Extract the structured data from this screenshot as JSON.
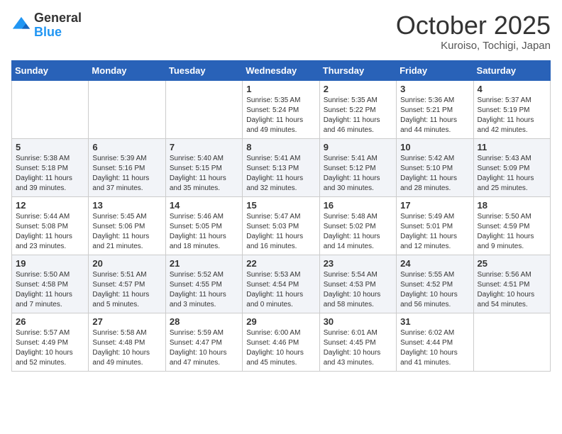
{
  "header": {
    "logo_general": "General",
    "logo_blue": "Blue",
    "month_title": "October 2025",
    "location": "Kuroiso, Tochigi, Japan"
  },
  "weekdays": [
    "Sunday",
    "Monday",
    "Tuesday",
    "Wednesday",
    "Thursday",
    "Friday",
    "Saturday"
  ],
  "rows": [
    {
      "cells": [
        {
          "day": "",
          "info": ""
        },
        {
          "day": "",
          "info": ""
        },
        {
          "day": "",
          "info": ""
        },
        {
          "day": "1",
          "info": "Sunrise: 5:35 AM\nSunset: 5:24 PM\nDaylight: 11 hours\nand 49 minutes."
        },
        {
          "day": "2",
          "info": "Sunrise: 5:35 AM\nSunset: 5:22 PM\nDaylight: 11 hours\nand 46 minutes."
        },
        {
          "day": "3",
          "info": "Sunrise: 5:36 AM\nSunset: 5:21 PM\nDaylight: 11 hours\nand 44 minutes."
        },
        {
          "day": "4",
          "info": "Sunrise: 5:37 AM\nSunset: 5:19 PM\nDaylight: 11 hours\nand 42 minutes."
        }
      ]
    },
    {
      "cells": [
        {
          "day": "5",
          "info": "Sunrise: 5:38 AM\nSunset: 5:18 PM\nDaylight: 11 hours\nand 39 minutes."
        },
        {
          "day": "6",
          "info": "Sunrise: 5:39 AM\nSunset: 5:16 PM\nDaylight: 11 hours\nand 37 minutes."
        },
        {
          "day": "7",
          "info": "Sunrise: 5:40 AM\nSunset: 5:15 PM\nDaylight: 11 hours\nand 35 minutes."
        },
        {
          "day": "8",
          "info": "Sunrise: 5:41 AM\nSunset: 5:13 PM\nDaylight: 11 hours\nand 32 minutes."
        },
        {
          "day": "9",
          "info": "Sunrise: 5:41 AM\nSunset: 5:12 PM\nDaylight: 11 hours\nand 30 minutes."
        },
        {
          "day": "10",
          "info": "Sunrise: 5:42 AM\nSunset: 5:10 PM\nDaylight: 11 hours\nand 28 minutes."
        },
        {
          "day": "11",
          "info": "Sunrise: 5:43 AM\nSunset: 5:09 PM\nDaylight: 11 hours\nand 25 minutes."
        }
      ]
    },
    {
      "cells": [
        {
          "day": "12",
          "info": "Sunrise: 5:44 AM\nSunset: 5:08 PM\nDaylight: 11 hours\nand 23 minutes."
        },
        {
          "day": "13",
          "info": "Sunrise: 5:45 AM\nSunset: 5:06 PM\nDaylight: 11 hours\nand 21 minutes."
        },
        {
          "day": "14",
          "info": "Sunrise: 5:46 AM\nSunset: 5:05 PM\nDaylight: 11 hours\nand 18 minutes."
        },
        {
          "day": "15",
          "info": "Sunrise: 5:47 AM\nSunset: 5:03 PM\nDaylight: 11 hours\nand 16 minutes."
        },
        {
          "day": "16",
          "info": "Sunrise: 5:48 AM\nSunset: 5:02 PM\nDaylight: 11 hours\nand 14 minutes."
        },
        {
          "day": "17",
          "info": "Sunrise: 5:49 AM\nSunset: 5:01 PM\nDaylight: 11 hours\nand 12 minutes."
        },
        {
          "day": "18",
          "info": "Sunrise: 5:50 AM\nSunset: 4:59 PM\nDaylight: 11 hours\nand 9 minutes."
        }
      ]
    },
    {
      "cells": [
        {
          "day": "19",
          "info": "Sunrise: 5:50 AM\nSunset: 4:58 PM\nDaylight: 11 hours\nand 7 minutes."
        },
        {
          "day": "20",
          "info": "Sunrise: 5:51 AM\nSunset: 4:57 PM\nDaylight: 11 hours\nand 5 minutes."
        },
        {
          "day": "21",
          "info": "Sunrise: 5:52 AM\nSunset: 4:55 PM\nDaylight: 11 hours\nand 3 minutes."
        },
        {
          "day": "22",
          "info": "Sunrise: 5:53 AM\nSunset: 4:54 PM\nDaylight: 11 hours\nand 0 minutes."
        },
        {
          "day": "23",
          "info": "Sunrise: 5:54 AM\nSunset: 4:53 PM\nDaylight: 10 hours\nand 58 minutes."
        },
        {
          "day": "24",
          "info": "Sunrise: 5:55 AM\nSunset: 4:52 PM\nDaylight: 10 hours\nand 56 minutes."
        },
        {
          "day": "25",
          "info": "Sunrise: 5:56 AM\nSunset: 4:51 PM\nDaylight: 10 hours\nand 54 minutes."
        }
      ]
    },
    {
      "cells": [
        {
          "day": "26",
          "info": "Sunrise: 5:57 AM\nSunset: 4:49 PM\nDaylight: 10 hours\nand 52 minutes."
        },
        {
          "day": "27",
          "info": "Sunrise: 5:58 AM\nSunset: 4:48 PM\nDaylight: 10 hours\nand 49 minutes."
        },
        {
          "day": "28",
          "info": "Sunrise: 5:59 AM\nSunset: 4:47 PM\nDaylight: 10 hours\nand 47 minutes."
        },
        {
          "day": "29",
          "info": "Sunrise: 6:00 AM\nSunset: 4:46 PM\nDaylight: 10 hours\nand 45 minutes."
        },
        {
          "day": "30",
          "info": "Sunrise: 6:01 AM\nSunset: 4:45 PM\nDaylight: 10 hours\nand 43 minutes."
        },
        {
          "day": "31",
          "info": "Sunrise: 6:02 AM\nSunset: 4:44 PM\nDaylight: 10 hours\nand 41 minutes."
        },
        {
          "day": "",
          "info": ""
        }
      ]
    }
  ]
}
